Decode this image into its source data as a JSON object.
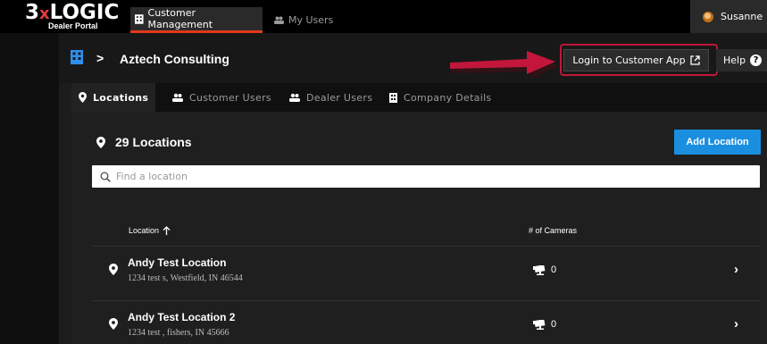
{
  "topbar": {
    "logo_main": "3",
    "logo_x": "x",
    "logo_rest": "LOGIC",
    "logo_sub": "Dealer Portal",
    "nav": [
      {
        "label": "Customer Management",
        "icon": "building-icon",
        "active": true
      },
      {
        "label": "My Users",
        "icon": "users-icon",
        "active": false
      }
    ],
    "user_name": "Susanne"
  },
  "header": {
    "breadcrumb_separator": ">",
    "customer_name": "Aztech Consulting",
    "login_button": "Login to Customer App",
    "help_button": "Help",
    "help_icon": "?"
  },
  "tabs": [
    {
      "label": "Locations",
      "icon": "location-pin-icon",
      "active": true
    },
    {
      "label": "Customer Users",
      "icon": "users-icon",
      "active": false
    },
    {
      "label": "Dealer Users",
      "icon": "users-icon",
      "active": false
    },
    {
      "label": "Company Details",
      "icon": "building-icon",
      "active": false
    }
  ],
  "locations": {
    "count_label": "29 Locations",
    "add_button": "Add Location",
    "search_placeholder": "Find a location",
    "columns": {
      "location": "Location",
      "cameras": "# of Cameras"
    },
    "rows": [
      {
        "name": "Andy Test Location",
        "address": "1234 test s, Westfield, IN 46544",
        "cameras": "0"
      },
      {
        "name": "Andy Test Location 2",
        "address": "1234 test , fishers, IN 45666",
        "cameras": "0"
      }
    ]
  },
  "colors": {
    "accent_blue": "#1a8fe0",
    "nav_active_underline": "#e0391b",
    "highlight_red": "#c2163a"
  }
}
